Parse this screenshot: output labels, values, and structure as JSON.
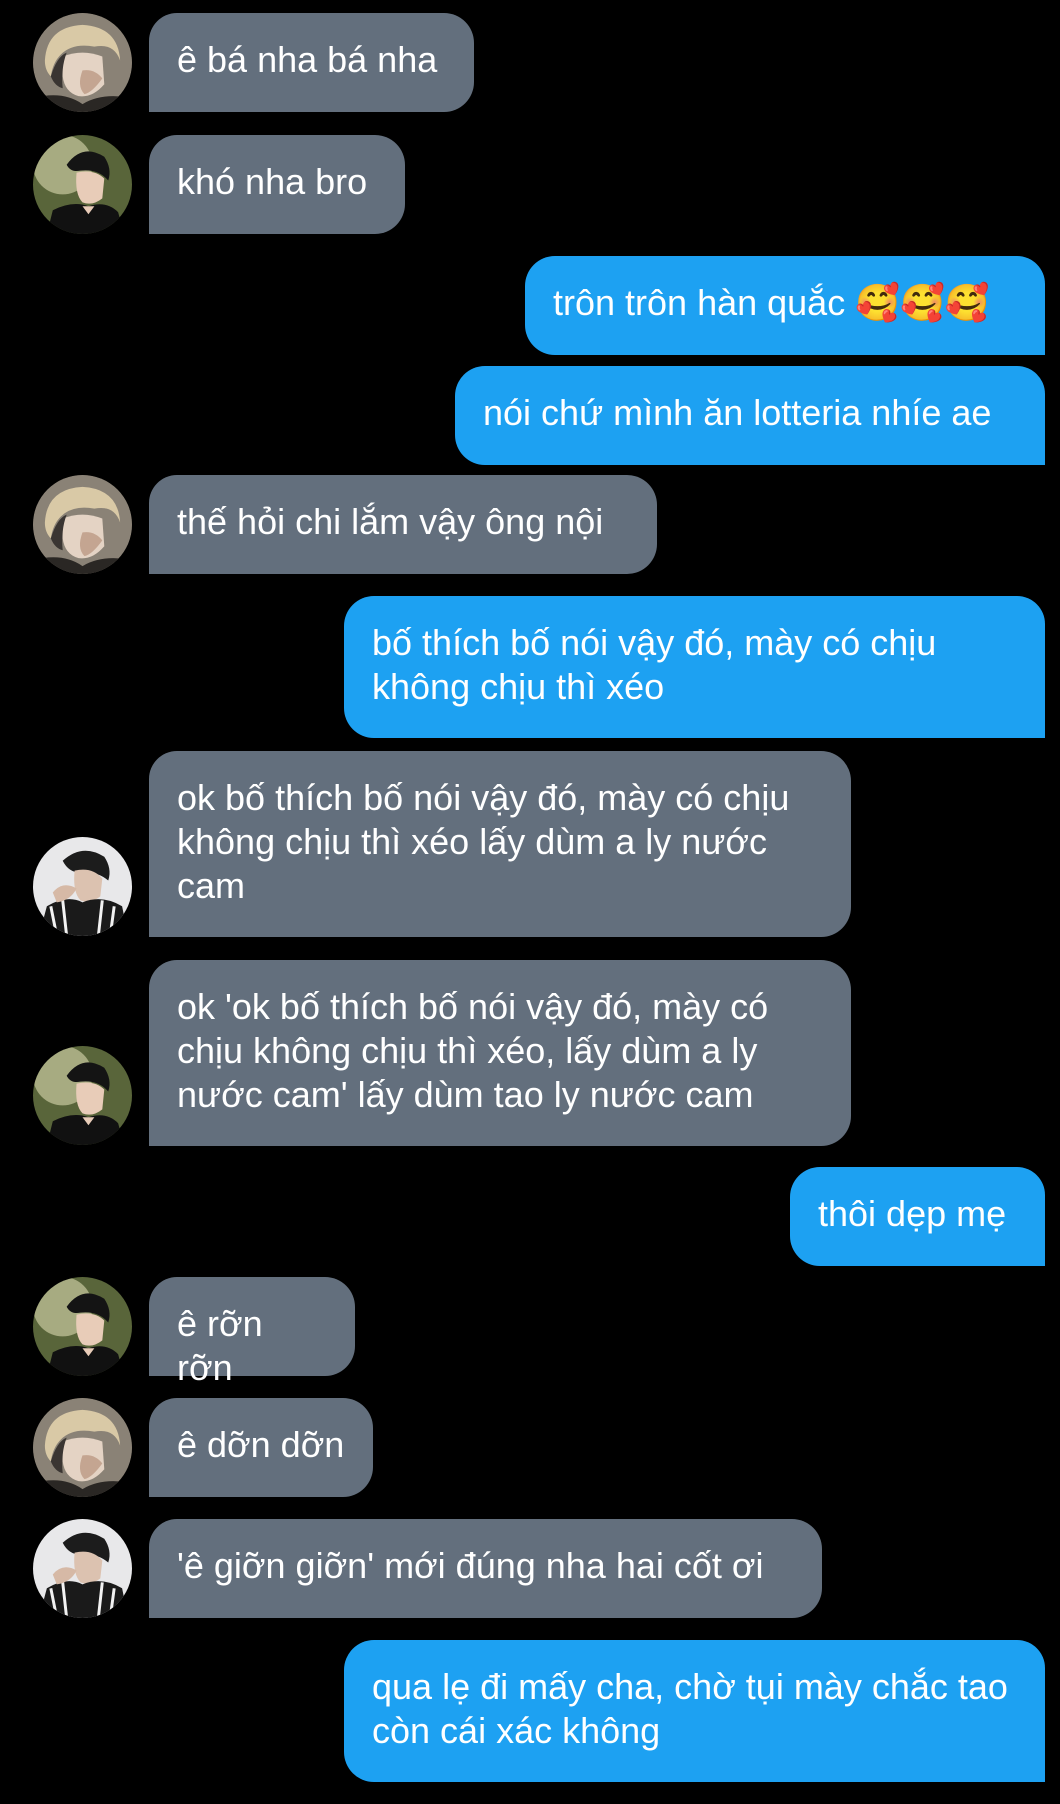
{
  "colors": {
    "background": "#000000",
    "incoming_bubble": "#636f7d",
    "outgoing_bubble": "#1da1f2",
    "text": "#ffffff"
  },
  "messages": [
    {
      "side": "in",
      "avatar": "avatar-blonde-icon",
      "text": "ê bá nha bá nha"
    },
    {
      "side": "in",
      "avatar": "avatar-black-shirt-icon",
      "text": "khó nha bro"
    },
    {
      "side": "out",
      "text": "trôn trôn hàn quắc 🥰🥰🥰"
    },
    {
      "side": "out",
      "text": "nói chứ mình ăn lotteria nhíe ae"
    },
    {
      "side": "in",
      "avatar": "avatar-blonde-icon",
      "text": "thế hỏi chi lắm vậy ông nội"
    },
    {
      "side": "out",
      "text": "bố thích bố nói vậy đó, mày có chịu không chịu thì xéo"
    },
    {
      "side": "in",
      "avatar": "avatar-jacket-icon",
      "text": "ok bố thích bố nói vậy đó, mày có chịu không chịu thì xéo lấy dùm a ly nước cam"
    },
    {
      "side": "in",
      "avatar": "avatar-black-shirt-icon",
      "text": "ok 'ok bố thích bố nói vậy đó, mày có chịu không chịu thì xéo, lấy dùm a ly nước cam' lấy dùm tao ly nước cam"
    },
    {
      "side": "out",
      "text": "thôi dẹp mẹ"
    },
    {
      "side": "in",
      "avatar": "avatar-black-shirt-icon",
      "text": "ê rỡn rỡn"
    },
    {
      "side": "in",
      "avatar": "avatar-blonde-icon",
      "text": "ê dỡn dỡn"
    },
    {
      "side": "in",
      "avatar": "avatar-jacket-icon",
      "text": "'ê giỡn giỡn' mới đúng nha hai cốt ơi"
    },
    {
      "side": "out",
      "text": "qua lẹ đi mấy cha, chờ tụi mày chắc tao còn cái xác không"
    }
  ]
}
